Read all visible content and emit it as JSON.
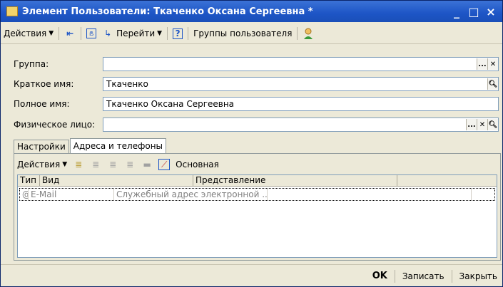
{
  "window": {
    "title": "Элемент Пользователи: Ткаченко Оксана Сергеевна *",
    "minimize": "_",
    "maximize": "□",
    "close": "×"
  },
  "toolbar": {
    "actions": "Действия",
    "go": "Перейти",
    "help": "?",
    "groups": "Группы пользователя"
  },
  "fields": [
    {
      "label": "Группа:",
      "value": ""
    },
    {
      "label": "Краткое имя:",
      "value": "Ткаченко"
    },
    {
      "label": "Полное имя:",
      "value": "Ткаченко Оксана Сергеевна"
    },
    {
      "label": "Физическое лицо:",
      "value": ""
    }
  ],
  "tabs": [
    "Настройки",
    "Адреса и телефоны"
  ],
  "panel": {
    "actions": "Действия",
    "main": "Основная"
  },
  "table": {
    "columns": [
      "Тип",
      "Вид",
      "Представление"
    ],
    "rows": [
      {
        "icon": "@",
        "type": "E-Mail",
        "kind": "Служебный адрес электронной ...",
        "repr": ""
      }
    ]
  },
  "footer": {
    "ok": "OK",
    "save": "Записать",
    "close": "Закрыть"
  }
}
